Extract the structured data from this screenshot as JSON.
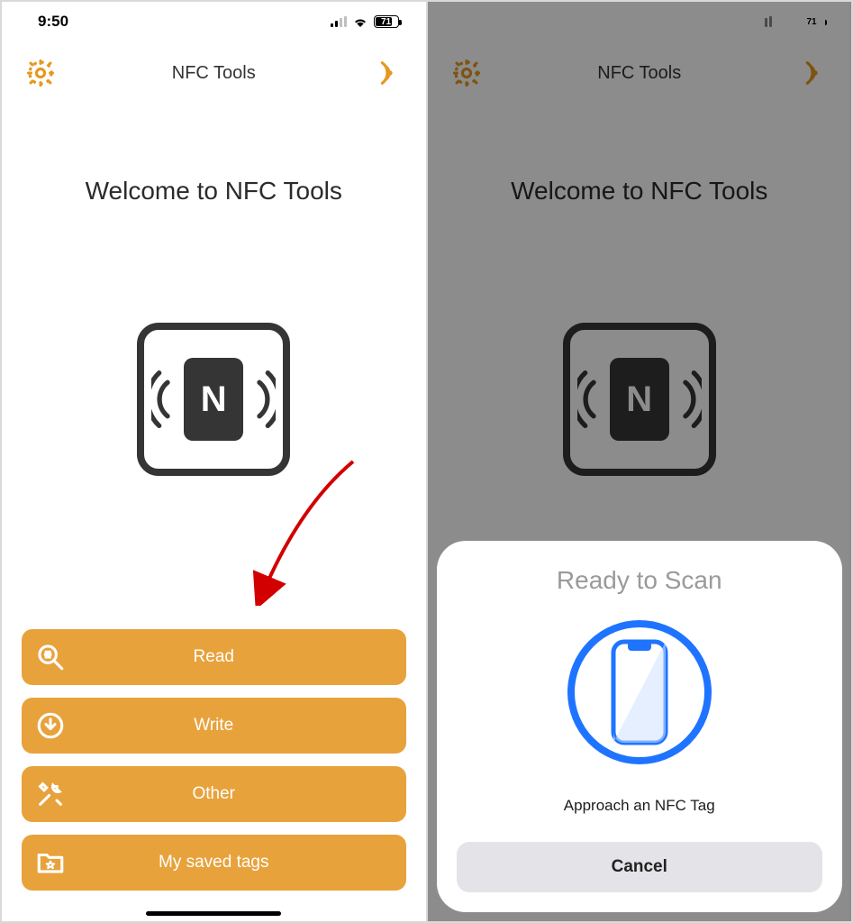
{
  "status": {
    "time": "9:50",
    "battery_pct": "71"
  },
  "header": {
    "title": "NFC Tools"
  },
  "welcome_text": "Welcome to NFC Tools",
  "nfc_chip_letter": "N",
  "buttons": {
    "read": "Read",
    "write": "Write",
    "other": "Other",
    "saved": "My saved tags"
  },
  "sheet": {
    "title": "Ready to Scan",
    "message": "Approach an NFC Tag",
    "cancel": "Cancel"
  },
  "colors": {
    "accent": "#e8a23b",
    "brand_icon": "#e6981e",
    "scan_blue": "#1f74ff"
  }
}
